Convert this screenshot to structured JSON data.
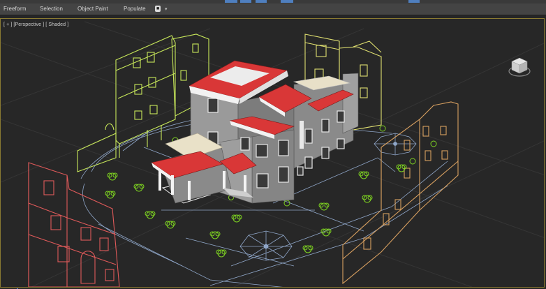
{
  "ribbon": {
    "tabs": [
      "Freeform",
      "Selection",
      "Object Paint",
      "Populate"
    ],
    "toggle_label": "■",
    "dropdown_glyph": "▾"
  },
  "viewport": {
    "bracket_plus": "[ + ]",
    "view_label": "[Perspective ]",
    "shading_label": "[ Shaded ]"
  },
  "colors": {
    "background": "#272727",
    "viewport_border": "#8a7a32",
    "building_green": "#c8e85a",
    "building_yellow": "#e0e070",
    "building_red": "#e05a5a",
    "building_orange": "#d8a060",
    "ground_lines": "#8fa6c8",
    "trees": "#7ed321",
    "roof_red": "#d93737",
    "walls_grey": "#8e8e8e"
  },
  "icons": {
    "viewcube": "viewcube-icon",
    "axis_gizmo": "axis-gizmo-icon"
  }
}
